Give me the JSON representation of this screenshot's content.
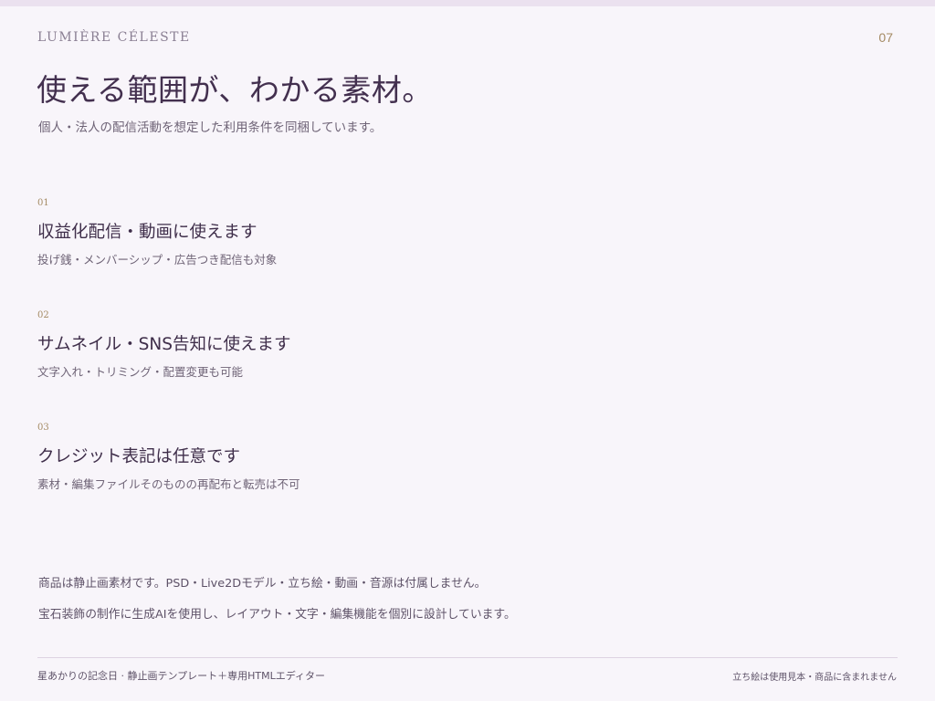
{
  "header": {
    "brand": "LUMIÈRE CÉLESTE",
    "page_number": "07"
  },
  "main": {
    "headline": "使える範囲が、わかる素材。",
    "subheadline": "個人・法人の配信活動を想定した利用条件を同梱しています。",
    "items": [
      {
        "number": "01",
        "title": "収益化配信・動画に使えます",
        "description": "投げ銭・メンバーシップ・広告つき配信も対象"
      },
      {
        "number": "02",
        "title": "サムネイル・SNS告知に使えます",
        "description": "文字入れ・トリミング・配置変更も可能"
      },
      {
        "number": "03",
        "title": "クレジット表記は任意です",
        "description": "素材・編集ファイルそのものの再配布と転売は不可"
      }
    ],
    "notes": [
      "商品は静止画素材です。PSD・Live2Dモデル・立ち絵・動画・音源は付属しません。",
      "宝石装飾の制作に生成AIを使用し、レイアウト・文字・編集機能を個別に設計しています。"
    ]
  },
  "footer": {
    "left": "星あかりの記念日 · 静止画テンプレート＋専用HTMLエディター",
    "right": "立ち絵は使用見本・商品に含まれません"
  },
  "colors": {
    "background": "#f8f5fa",
    "top_bar": "#ebe1ef",
    "heading": "#43304f",
    "accent_gold": "#a48a63",
    "muted_text": "#6f6477"
  }
}
